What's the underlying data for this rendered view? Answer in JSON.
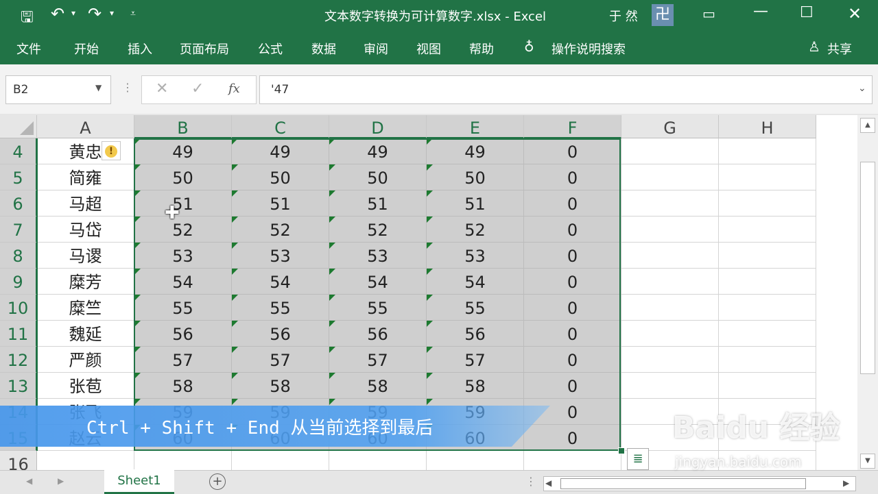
{
  "window": {
    "title": "文本数字转换为可计算数字.xlsx  -  Excel",
    "user": "于 然",
    "colors": {
      "brand": "#217346",
      "selection": "#cfcfcf",
      "error_triangle": "#1d7a30"
    }
  },
  "ribbon": {
    "tabs": [
      "文件",
      "开始",
      "插入",
      "页面布局",
      "公式",
      "数据",
      "审阅",
      "视图",
      "帮助"
    ],
    "tell_me": "操作说明搜索",
    "share": "共享"
  },
  "formula_bar": {
    "name_box": "B2",
    "fx_label": "fx",
    "value": "'47"
  },
  "columns": [
    "A",
    "B",
    "C",
    "D",
    "E",
    "F",
    "G",
    "H"
  ],
  "rows": [
    {
      "num": "4",
      "a": "黄忠",
      "b": "49",
      "c": "49",
      "d": "49",
      "e": "49",
      "f": "0"
    },
    {
      "num": "5",
      "a": "简雍",
      "b": "50",
      "c": "50",
      "d": "50",
      "e": "50",
      "f": "0"
    },
    {
      "num": "6",
      "a": "马超",
      "b": "51",
      "c": "51",
      "d": "51",
      "e": "51",
      "f": "0"
    },
    {
      "num": "7",
      "a": "马岱",
      "b": "52",
      "c": "52",
      "d": "52",
      "e": "52",
      "f": "0"
    },
    {
      "num": "8",
      "a": "马谡",
      "b": "53",
      "c": "53",
      "d": "53",
      "e": "53",
      "f": "0"
    },
    {
      "num": "9",
      "a": "糜芳",
      "b": "54",
      "c": "54",
      "d": "54",
      "e": "54",
      "f": "0"
    },
    {
      "num": "10",
      "a": "糜竺",
      "b": "55",
      "c": "55",
      "d": "55",
      "e": "55",
      "f": "0"
    },
    {
      "num": "11",
      "a": "魏延",
      "b": "56",
      "c": "56",
      "d": "56",
      "e": "56",
      "f": "0"
    },
    {
      "num": "12",
      "a": "严颜",
      "b": "57",
      "c": "57",
      "d": "57",
      "e": "57",
      "f": "0"
    },
    {
      "num": "13",
      "a": "张苞",
      "b": "58",
      "c": "58",
      "d": "58",
      "e": "58",
      "f": "0"
    },
    {
      "num": "14",
      "a": "张飞",
      "b": "59",
      "c": "59",
      "d": "59",
      "e": "59",
      "f": "0"
    },
    {
      "num": "15",
      "a": "赵云",
      "b": "60",
      "c": "60",
      "d": "60",
      "e": "60",
      "f": "0"
    },
    {
      "num": "16",
      "a": "",
      "b": "",
      "c": "",
      "d": "",
      "e": "",
      "f": ""
    }
  ],
  "sheets": [
    "Sheet1"
  ],
  "caption": "Ctrl + Shift + End 从当前选择到最后",
  "watermark": {
    "text": "Baidu 经验",
    "sub": "jingyan.baidu.com"
  }
}
